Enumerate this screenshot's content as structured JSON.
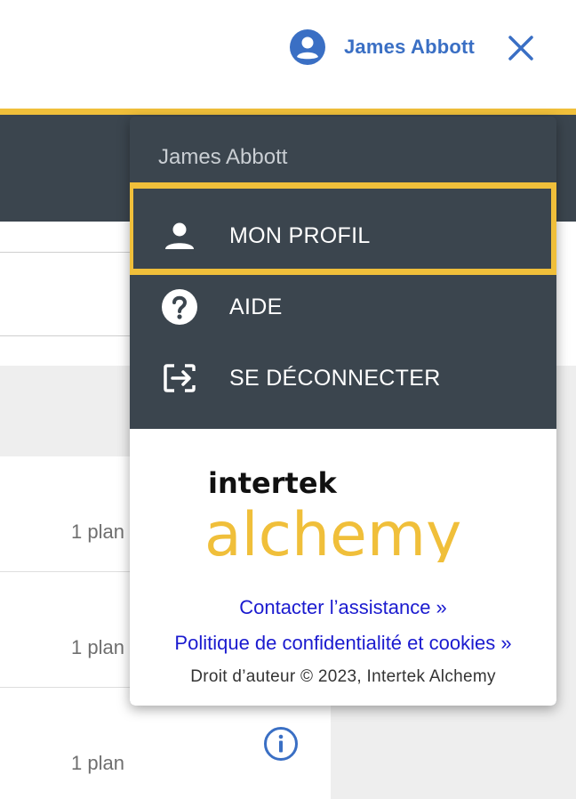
{
  "header": {
    "user_name": "James Abbott",
    "user_icon": "account-circle-icon",
    "close_icon": "close-icon"
  },
  "list": {
    "rows": [
      {
        "plan": "1 plan"
      },
      {
        "plan": "1 plan"
      },
      {
        "plan": "1 plan"
      }
    ],
    "info_icon": "info-icon"
  },
  "menu": {
    "header": "James Abbott",
    "items": [
      {
        "label": "MON PROFIL",
        "icon": "person-icon"
      },
      {
        "label": "AIDE",
        "icon": "help-icon"
      },
      {
        "label": "SE DÉCONNECTER",
        "icon": "logout-icon"
      }
    ],
    "logo_top": "intertek",
    "logo_bottom": "alchemy",
    "support_link": "Contacter l’assistance »",
    "privacy_link": "Politique de confidentialité et cookies »",
    "copyright": "Droit d’auteur © 2023, Intertek Alchemy"
  },
  "colors": {
    "accent_blue": "#3a6fc4",
    "highlight_gold": "#f0bf3a",
    "menu_bg": "#3b454e",
    "link_blue": "#1a1acf"
  }
}
